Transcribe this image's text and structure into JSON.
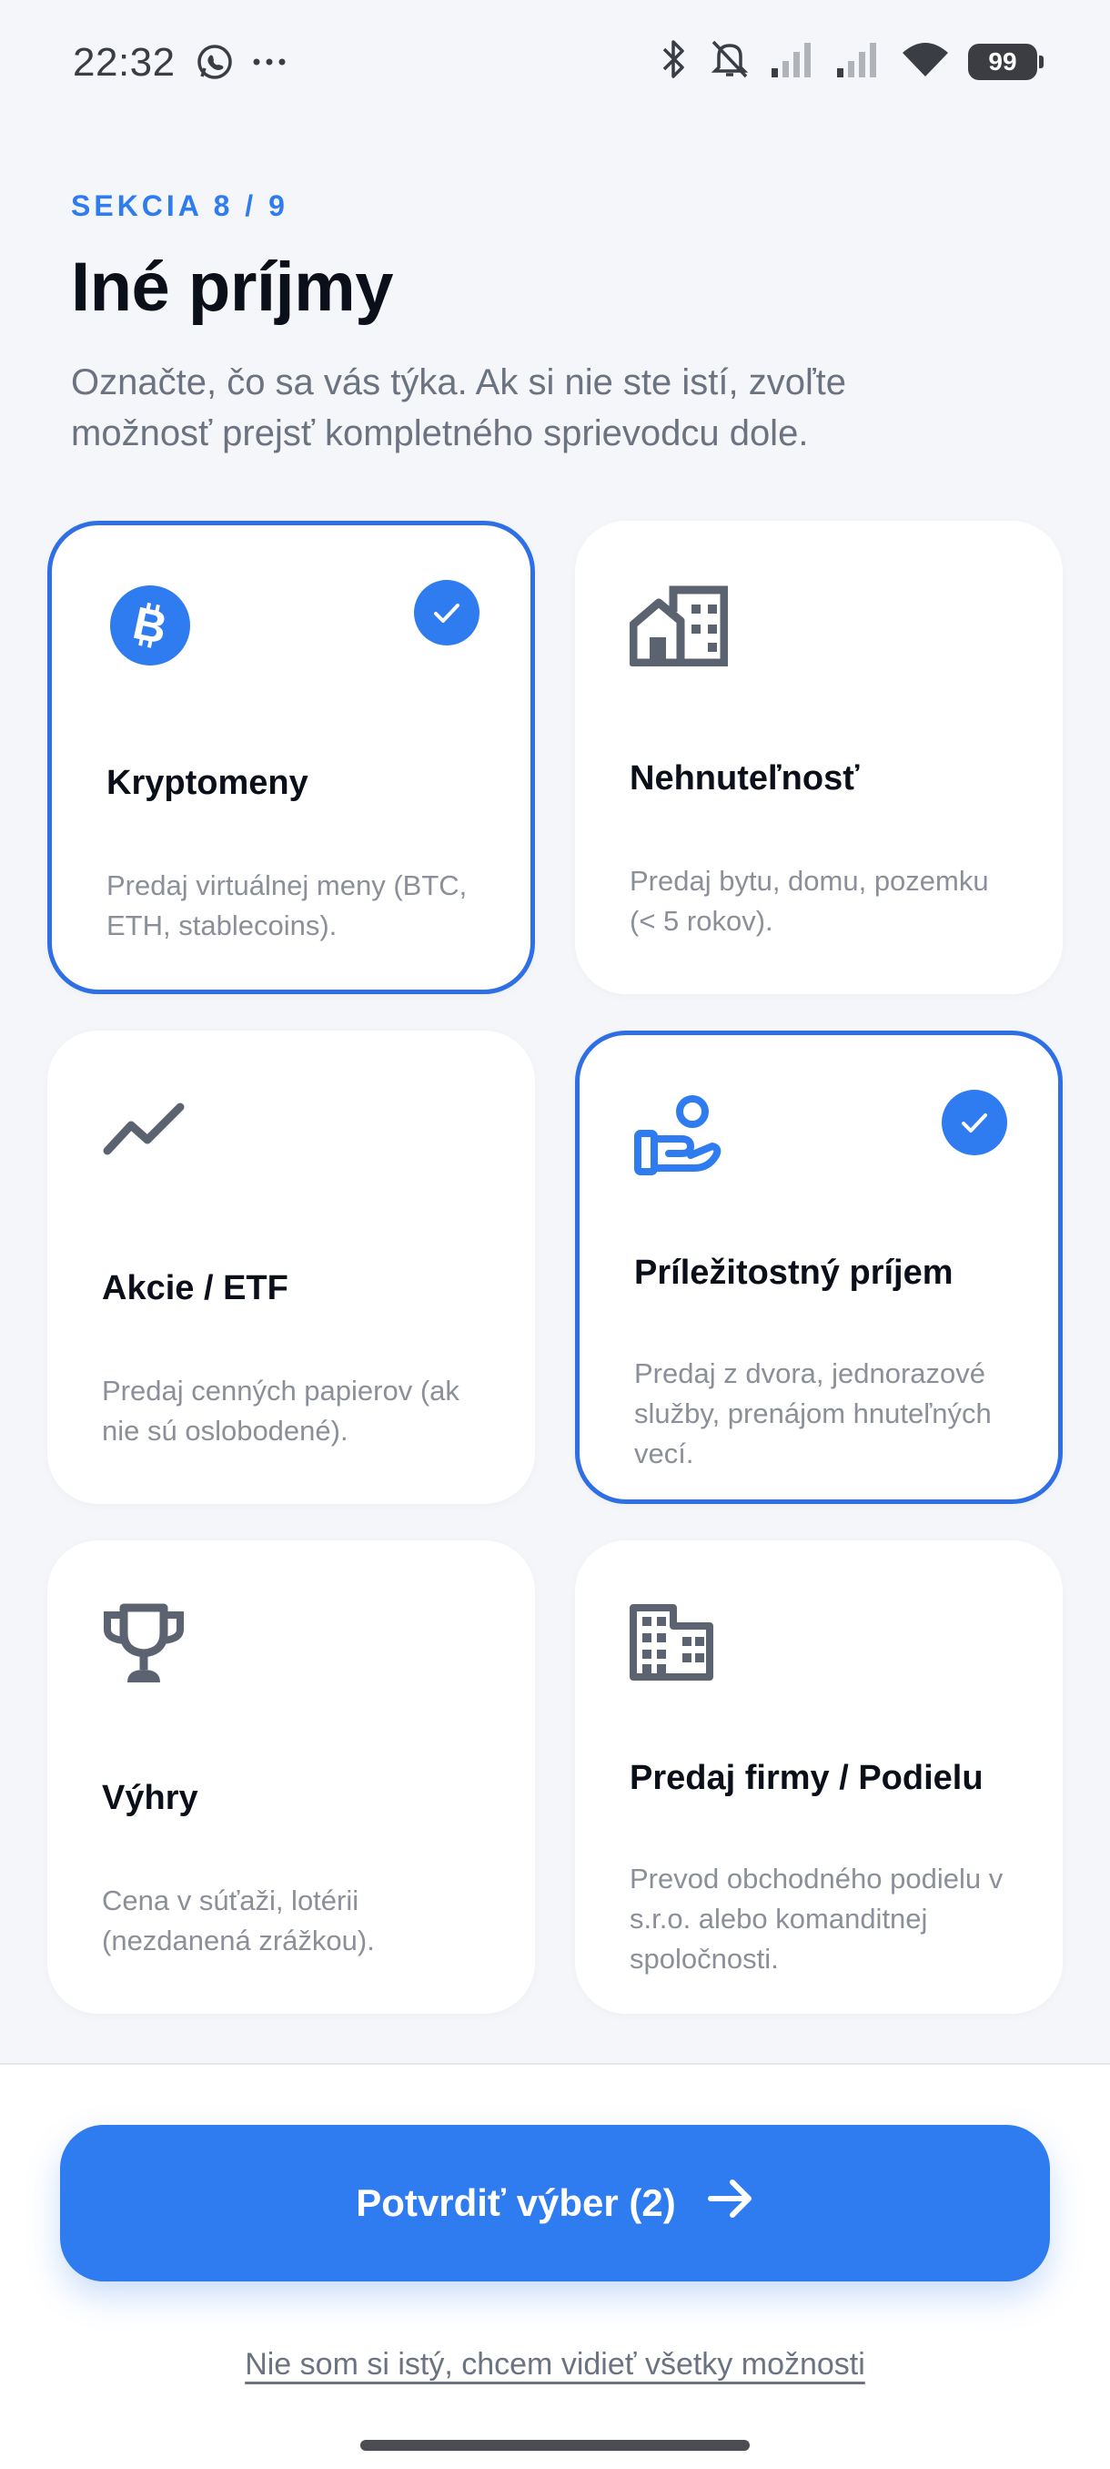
{
  "status_bar": {
    "time": "22:32",
    "battery": "99",
    "left_icons": [
      "whatsapp-icon",
      "more-dots-icon"
    ],
    "right_icons": [
      "bluetooth-icon",
      "mute-icon",
      "signal-icon",
      "signal-icon",
      "wifi-icon",
      "battery-icon"
    ]
  },
  "header": {
    "section_label": "SEKCIA 8 / 9",
    "title": "Iné príjmy",
    "subtitle": "Označte, čo sa vás týka. Ak si nie ste istí, zvoľte možnosť prejsť kompletného sprievodcu dole."
  },
  "colors": {
    "accent": "#2f7bf0",
    "icon_gray": "#5c6370"
  },
  "cards": [
    {
      "title": "Kryptomeny",
      "description": "Predaj virtuálnej meny (BTC, ETH, stablecoins).",
      "icon": "bitcoin-icon",
      "selected": true
    },
    {
      "title": "Nehnuteľnosť",
      "description": "Predaj bytu, domu, pozemku (< 5 rokov).",
      "icon": "real-estate-icon",
      "selected": false
    },
    {
      "title": "Akcie / ETF",
      "description": "Predaj cenných papierov (ak nie sú oslobodené).",
      "icon": "trending-up-icon",
      "selected": false
    },
    {
      "title": "Príležitostný príjem",
      "description": "Predaj z dvora, jednorazové služby, prenájom hnuteľných vecí.",
      "icon": "hand-person-icon",
      "selected": true
    },
    {
      "title": "Výhry",
      "description": "Cena v súťaži, lotérii (nezdanená zrážkou).",
      "icon": "trophy-icon",
      "selected": false
    },
    {
      "title": "Predaj firmy / Podielu",
      "description": "Prevod obchodného podielu v s.r.o. alebo komanditnej spoločnosti.",
      "icon": "building-icon",
      "selected": false
    }
  ],
  "footer": {
    "confirm_label": "Potvrdiť výber (2)",
    "all_options_link": "Nie som si istý, chcem vidieť všetky možnosti"
  }
}
